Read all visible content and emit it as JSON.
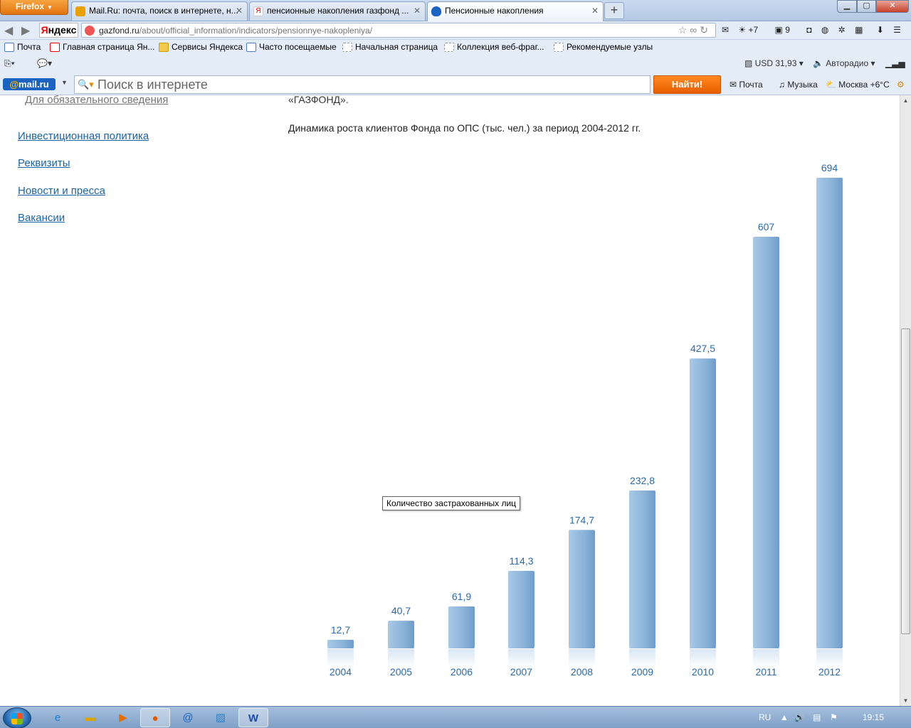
{
  "browser": {
    "menu_button": "Firefox",
    "tabs": [
      {
        "label": "Mail.Ru: почта, поиск в интернете, н...",
        "favicon_color": "#e8a100",
        "active": false
      },
      {
        "label": "пенсионные накопления газфонд ...",
        "favicon_color": "#e00000",
        "active": false
      },
      {
        "label": "Пенсионные накопления",
        "favicon_color": "#1a63c1",
        "active": true
      }
    ],
    "url_host": "gazfond.ru",
    "url_path": "/about/official_information/indicators/pensionnye-nakopleniya/",
    "yandex_logo": "Яндекс",
    "nav_right": {
      "weather": "+7",
      "mail_count": "9"
    },
    "bookmarks": [
      "Почта",
      "Главная страница Ян...",
      "Сервисы Яндекса",
      "Часто посещаемые",
      "Начальная страница",
      "Коллекция веб-фраг...",
      "Рекомендуемые узлы"
    ],
    "currency": "USD 31,93",
    "radio": "Авторадио"
  },
  "mailbar": {
    "logo": "@mail.ru",
    "search_placeholder": "Поиск в интернете",
    "find_button": "Найти!",
    "mail_link": "Почта",
    "music_link": "Музыка",
    "weather": "Москва +6°C"
  },
  "page": {
    "sidebar_cut": "Для обязательного сведения",
    "sidebar_links": [
      "Инвестиционная политика",
      "Реквизиты",
      "Новости и пресса",
      "Вакансии"
    ],
    "intro_cut": "«ГАЗФОНД».",
    "chart_caption": "Динамика роста клиентов Фонда по ОПС (тыс. чел.) за период 2004-2012 гг.",
    "tooltip": "Количество застрахованных лиц"
  },
  "chart_data": {
    "type": "bar",
    "categories": [
      "2004",
      "2005",
      "2006",
      "2007",
      "2008",
      "2009",
      "2010",
      "2011",
      "2012"
    ],
    "values": [
      12.7,
      40.7,
      61.9,
      114.3,
      174.7,
      232.8,
      427.5,
      607,
      694
    ],
    "value_labels": [
      "12,7",
      "40,7",
      "61,9",
      "114,3",
      "174,7",
      "232,8",
      "427,5",
      "607",
      "694"
    ],
    "title": "",
    "ylim": [
      0,
      694
    ],
    "grid": false,
    "bar_color": "#8ab3d9",
    "label_color": "#2a6aa8"
  },
  "taskbar": {
    "apps": [
      "ie-icon",
      "explorer-icon",
      "media-player-icon",
      "firefox-icon",
      "mail-agent-icon",
      "paint-icon",
      "word-icon"
    ],
    "lang": "RU",
    "clock": "19:15"
  }
}
